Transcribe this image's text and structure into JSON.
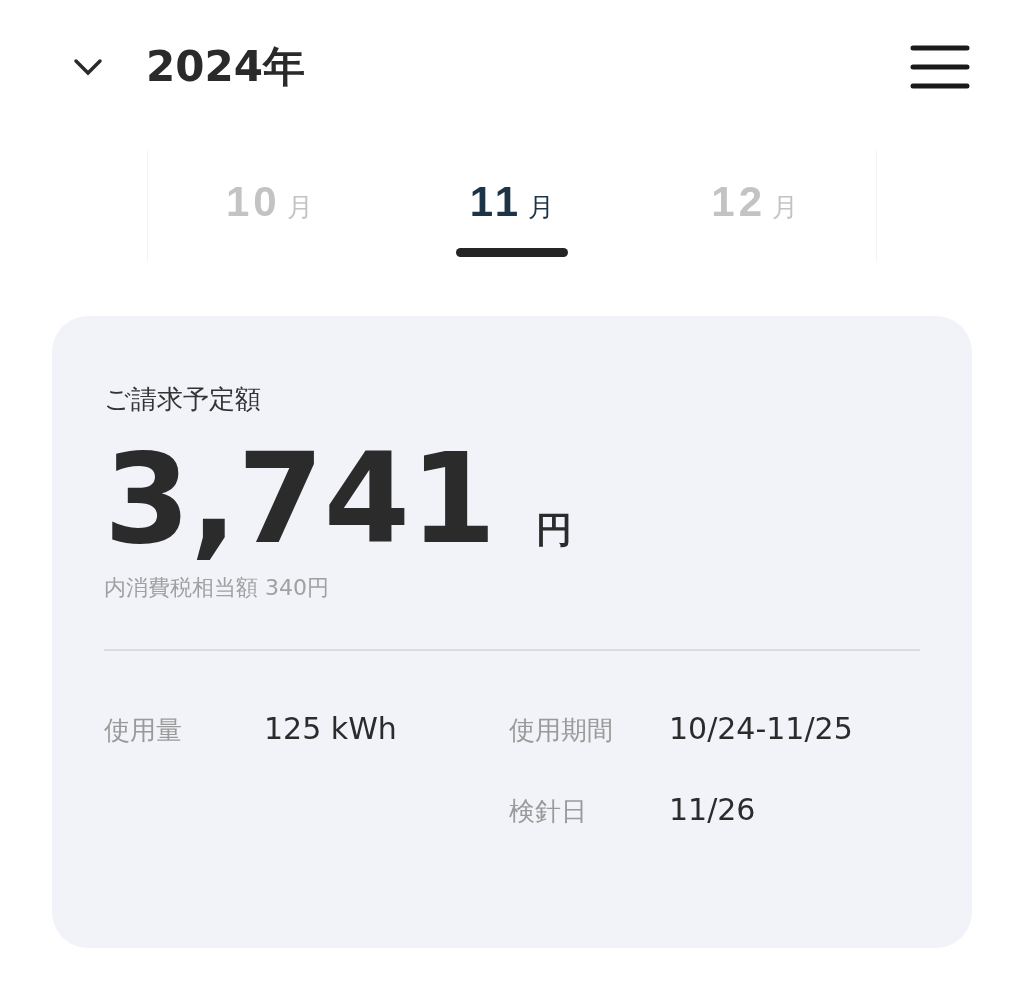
{
  "header": {
    "year": "2024年"
  },
  "months": [
    {
      "number": "10",
      "unit": "月",
      "selected": false
    },
    {
      "number": "11",
      "unit": "月",
      "selected": true
    },
    {
      "number": "12",
      "unit": "月",
      "selected": false
    }
  ],
  "bill": {
    "label": "ご請求予定額",
    "amount": "3,741",
    "currency": "円",
    "tax_note": "内消費税相当額 340円",
    "details": [
      {
        "label": "使用量",
        "value": "125 kWh"
      },
      {
        "label": "使用期間",
        "value": "10/24-11/25"
      },
      {
        "label": "検針日",
        "value": "11/26"
      }
    ]
  }
}
